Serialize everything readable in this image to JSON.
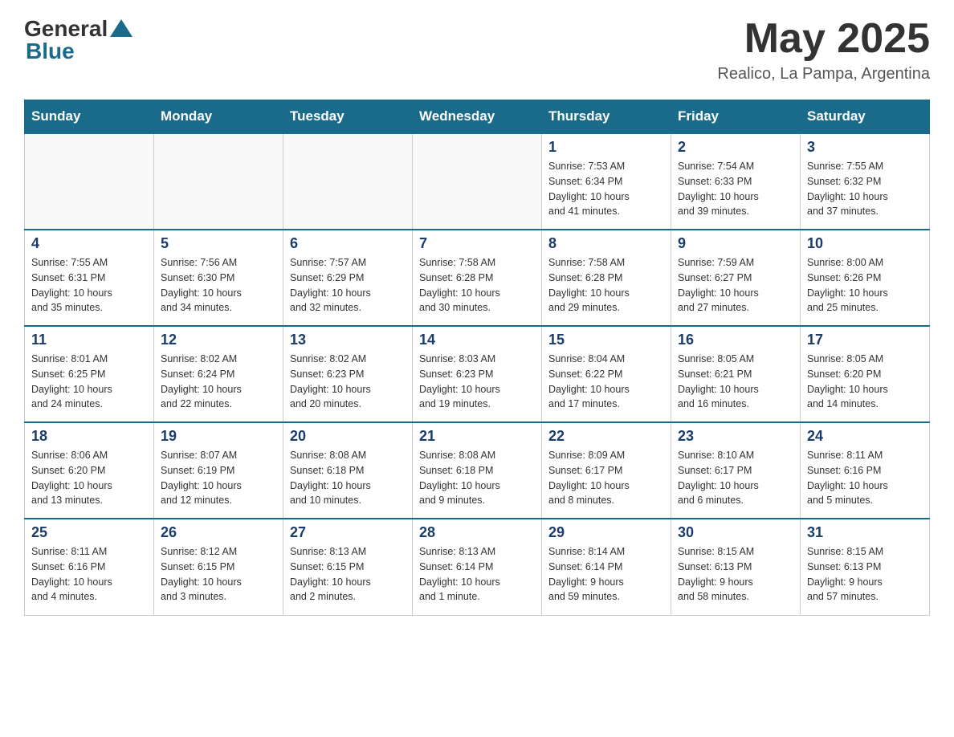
{
  "header": {
    "logo_general": "General",
    "logo_blue": "Blue",
    "month_year": "May 2025",
    "location": "Realico, La Pampa, Argentina"
  },
  "weekdays": [
    "Sunday",
    "Monday",
    "Tuesday",
    "Wednesday",
    "Thursday",
    "Friday",
    "Saturday"
  ],
  "weeks": [
    [
      {
        "day": "",
        "info": ""
      },
      {
        "day": "",
        "info": ""
      },
      {
        "day": "",
        "info": ""
      },
      {
        "day": "",
        "info": ""
      },
      {
        "day": "1",
        "info": "Sunrise: 7:53 AM\nSunset: 6:34 PM\nDaylight: 10 hours\nand 41 minutes."
      },
      {
        "day": "2",
        "info": "Sunrise: 7:54 AM\nSunset: 6:33 PM\nDaylight: 10 hours\nand 39 minutes."
      },
      {
        "day": "3",
        "info": "Sunrise: 7:55 AM\nSunset: 6:32 PM\nDaylight: 10 hours\nand 37 minutes."
      }
    ],
    [
      {
        "day": "4",
        "info": "Sunrise: 7:55 AM\nSunset: 6:31 PM\nDaylight: 10 hours\nand 35 minutes."
      },
      {
        "day": "5",
        "info": "Sunrise: 7:56 AM\nSunset: 6:30 PM\nDaylight: 10 hours\nand 34 minutes."
      },
      {
        "day": "6",
        "info": "Sunrise: 7:57 AM\nSunset: 6:29 PM\nDaylight: 10 hours\nand 32 minutes."
      },
      {
        "day": "7",
        "info": "Sunrise: 7:58 AM\nSunset: 6:28 PM\nDaylight: 10 hours\nand 30 minutes."
      },
      {
        "day": "8",
        "info": "Sunrise: 7:58 AM\nSunset: 6:28 PM\nDaylight: 10 hours\nand 29 minutes."
      },
      {
        "day": "9",
        "info": "Sunrise: 7:59 AM\nSunset: 6:27 PM\nDaylight: 10 hours\nand 27 minutes."
      },
      {
        "day": "10",
        "info": "Sunrise: 8:00 AM\nSunset: 6:26 PM\nDaylight: 10 hours\nand 25 minutes."
      }
    ],
    [
      {
        "day": "11",
        "info": "Sunrise: 8:01 AM\nSunset: 6:25 PM\nDaylight: 10 hours\nand 24 minutes."
      },
      {
        "day": "12",
        "info": "Sunrise: 8:02 AM\nSunset: 6:24 PM\nDaylight: 10 hours\nand 22 minutes."
      },
      {
        "day": "13",
        "info": "Sunrise: 8:02 AM\nSunset: 6:23 PM\nDaylight: 10 hours\nand 20 minutes."
      },
      {
        "day": "14",
        "info": "Sunrise: 8:03 AM\nSunset: 6:23 PM\nDaylight: 10 hours\nand 19 minutes."
      },
      {
        "day": "15",
        "info": "Sunrise: 8:04 AM\nSunset: 6:22 PM\nDaylight: 10 hours\nand 17 minutes."
      },
      {
        "day": "16",
        "info": "Sunrise: 8:05 AM\nSunset: 6:21 PM\nDaylight: 10 hours\nand 16 minutes."
      },
      {
        "day": "17",
        "info": "Sunrise: 8:05 AM\nSunset: 6:20 PM\nDaylight: 10 hours\nand 14 minutes."
      }
    ],
    [
      {
        "day": "18",
        "info": "Sunrise: 8:06 AM\nSunset: 6:20 PM\nDaylight: 10 hours\nand 13 minutes."
      },
      {
        "day": "19",
        "info": "Sunrise: 8:07 AM\nSunset: 6:19 PM\nDaylight: 10 hours\nand 12 minutes."
      },
      {
        "day": "20",
        "info": "Sunrise: 8:08 AM\nSunset: 6:18 PM\nDaylight: 10 hours\nand 10 minutes."
      },
      {
        "day": "21",
        "info": "Sunrise: 8:08 AM\nSunset: 6:18 PM\nDaylight: 10 hours\nand 9 minutes."
      },
      {
        "day": "22",
        "info": "Sunrise: 8:09 AM\nSunset: 6:17 PM\nDaylight: 10 hours\nand 8 minutes."
      },
      {
        "day": "23",
        "info": "Sunrise: 8:10 AM\nSunset: 6:17 PM\nDaylight: 10 hours\nand 6 minutes."
      },
      {
        "day": "24",
        "info": "Sunrise: 8:11 AM\nSunset: 6:16 PM\nDaylight: 10 hours\nand 5 minutes."
      }
    ],
    [
      {
        "day": "25",
        "info": "Sunrise: 8:11 AM\nSunset: 6:16 PM\nDaylight: 10 hours\nand 4 minutes."
      },
      {
        "day": "26",
        "info": "Sunrise: 8:12 AM\nSunset: 6:15 PM\nDaylight: 10 hours\nand 3 minutes."
      },
      {
        "day": "27",
        "info": "Sunrise: 8:13 AM\nSunset: 6:15 PM\nDaylight: 10 hours\nand 2 minutes."
      },
      {
        "day": "28",
        "info": "Sunrise: 8:13 AM\nSunset: 6:14 PM\nDaylight: 10 hours\nand 1 minute."
      },
      {
        "day": "29",
        "info": "Sunrise: 8:14 AM\nSunset: 6:14 PM\nDaylight: 9 hours\nand 59 minutes."
      },
      {
        "day": "30",
        "info": "Sunrise: 8:15 AM\nSunset: 6:13 PM\nDaylight: 9 hours\nand 58 minutes."
      },
      {
        "day": "31",
        "info": "Sunrise: 8:15 AM\nSunset: 6:13 PM\nDaylight: 9 hours\nand 57 minutes."
      }
    ]
  ]
}
